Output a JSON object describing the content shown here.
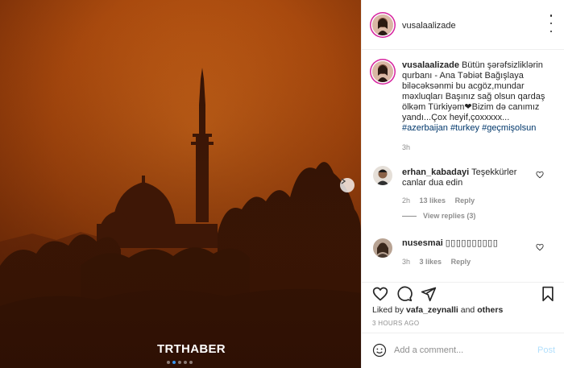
{
  "media": {
    "watermark": "TRTHABER",
    "carousel_total": 5,
    "carousel_active_index": 1,
    "sky_color": "#b8520f",
    "silhouette_color": "#1e0c04"
  },
  "post": {
    "username": "vusalaalizade",
    "caption_user": "vusalaalizade",
    "caption_text": "Bütün şərəfsizliklərin qurbanı - Ana Təbiət Bağışlaya biləcəksənmi bu acgöz,mundar məxluqları Başınız sağ olsun qardaş ölkəm Türkiyəm❤Bizim də canımız yandı...Çox heyif,çoxxxxx...",
    "hashtags": [
      "#azerbaijan",
      "#turkey",
      "#geçmişolsun"
    ],
    "caption_age": "3h"
  },
  "comments": [
    {
      "username": "erhan_kabadayi",
      "text": "Teşekkürler canlar dua edin",
      "age": "2h",
      "likes": "13 likes",
      "reply": "Reply",
      "view_replies": "View replies (3)"
    },
    {
      "username": "nusesmai",
      "text": "",
      "age": "3h",
      "likes": "3 likes",
      "reply": "Reply"
    }
  ],
  "footer": {
    "liked_prefix": "Liked by",
    "liked_user": "vafa_zeynalli",
    "liked_suffix": "and",
    "liked_others": "others",
    "timestamp": "3 HOURS AGO",
    "comment_placeholder": "Add a comment...",
    "post_label": "Post"
  },
  "colors": {
    "link": "#00376b",
    "muted": "#8e8e8e",
    "post_disabled": "#b2dffc",
    "story_ring": "#d6249f"
  }
}
